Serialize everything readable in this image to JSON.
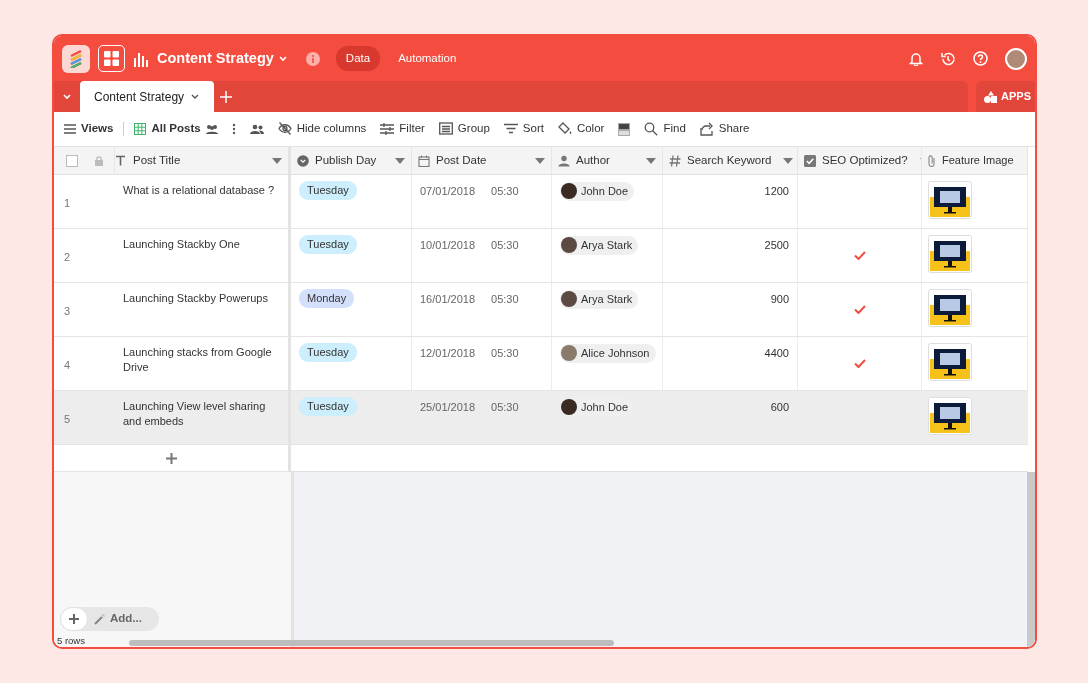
{
  "app": {
    "title": "Content Strategy",
    "nav": [
      {
        "label": "Data",
        "selected": true
      },
      {
        "label": "Automation",
        "selected": false
      }
    ]
  },
  "tabs": [
    {
      "label": "Content Strategy",
      "selected": true
    }
  ],
  "apps_button": "APPS",
  "toolbar": {
    "views": "Views",
    "view_name": "All Posts",
    "items": [
      "Hide columns",
      "Filter",
      "Group",
      "Sort",
      "Color",
      "Find",
      "Share"
    ]
  },
  "table": {
    "select_all_checked": false,
    "columns": [
      {
        "label": "Post Title",
        "kind": "text"
      },
      {
        "label": "Publish Day",
        "kind": "select"
      },
      {
        "label": "Post Date",
        "kind": "date"
      },
      {
        "label": "Author",
        "kind": "user"
      },
      {
        "label": "Search Keyword",
        "kind": "number"
      },
      {
        "label": "SEO Optimized?",
        "kind": "checkbox"
      },
      {
        "label": "Feature Image",
        "kind": "attachment"
      }
    ],
    "rows": [
      {
        "number": "1",
        "title": "What is a relational database ?",
        "publish_day": {
          "label": "Tuesday",
          "color": "#cdeefc"
        },
        "date": "07/01/2018",
        "time": "05:30",
        "author": "John Doe",
        "keyword": "1200",
        "seo_optimized": false,
        "selected": false
      },
      {
        "number": "2",
        "title": "Launching Stackby One",
        "publish_day": {
          "label": "Tuesday",
          "color": "#cdeefc"
        },
        "date": "10/01/2018",
        "time": "05:30",
        "author": "Arya Stark",
        "keyword": "2500",
        "seo_optimized": true,
        "selected": false
      },
      {
        "number": "3",
        "title": "Launching Stackby Powerups",
        "publish_day": {
          "label": "Monday",
          "color": "#d4e0fb"
        },
        "date": "16/01/2018",
        "time": "05:30",
        "author": "Arya Stark",
        "keyword": "900",
        "seo_optimized": true,
        "selected": false
      },
      {
        "number": "4",
        "title": "Launching stacks from Google Drive",
        "publish_day": {
          "label": "Tuesday",
          "color": "#cdeefc"
        },
        "date": "12/01/2018",
        "time": "05:30",
        "author": "Alice Johnson",
        "keyword": "4400",
        "seo_optimized": true,
        "selected": false
      },
      {
        "number": "5",
        "title": "Launching View level sharing and embeds",
        "publish_day": {
          "label": "Tuesday",
          "color": "#cdeefc"
        },
        "date": "25/01/2018",
        "time": "05:30",
        "author": "John Doe",
        "keyword": "600",
        "seo_optimized": false,
        "selected": true
      }
    ]
  },
  "footer": {
    "add_label": "Add...",
    "row_count": "5 rows"
  }
}
